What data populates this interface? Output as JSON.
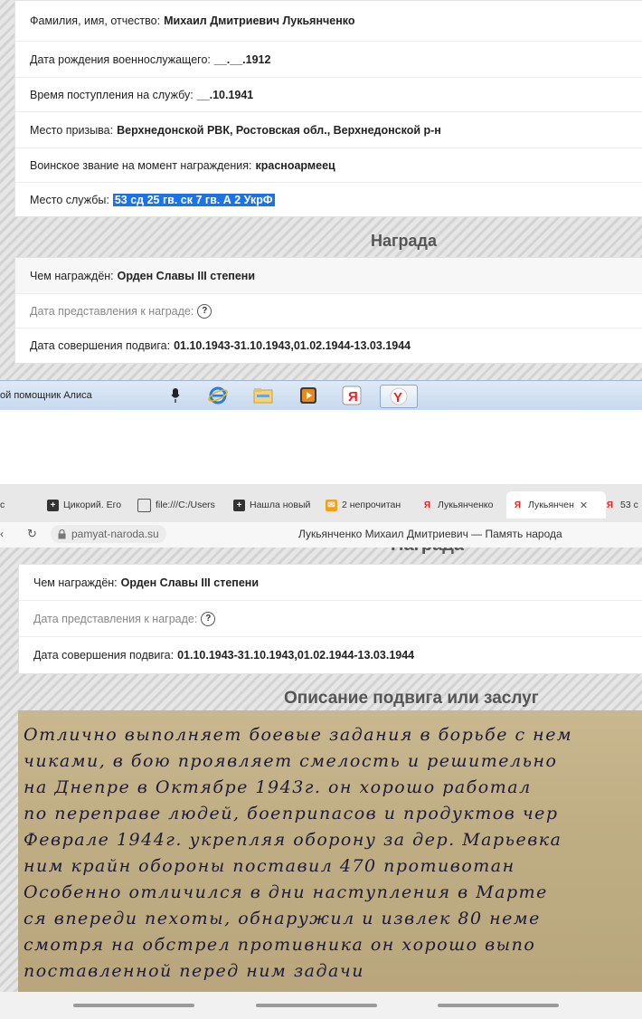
{
  "top": {
    "rows": [
      {
        "label": "Фамилия, имя, отчество:",
        "value": "Михаил Дмитриевич Лукьянченко"
      },
      {
        "label": "Дата рождения военнослужащего:",
        "value": "__.__.1912"
      },
      {
        "label": "Время поступления на службу:",
        "value": "__.10.1941"
      },
      {
        "label": "Место призыва:",
        "value": "Верхнедонской РВК, Ростовская обл., Верхнедонской р-н"
      },
      {
        "label": "Воинское звание на момент награждения:",
        "value": "красноармеец"
      },
      {
        "label": "Место службы:",
        "value": "53 сд 25 гв. ск 7 гв. А 2 УкрФ"
      }
    ],
    "award_title": "Награда",
    "award_rows": [
      {
        "label": "Чем награждён:",
        "value": "Орден Славы III степени"
      },
      {
        "label": "Дата представления к награде:",
        "value": ""
      },
      {
        "label": "Дата совершения подвига:",
        "value": "01.10.1943-31.10.1943,01.02.1944-13.03.1944"
      }
    ]
  },
  "taskbar": {
    "alice_label": "ой помощник Алиса"
  },
  "browser": {
    "tabs": [
      {
        "label": "с"
      },
      {
        "label": "Цикорий. Его"
      },
      {
        "label": "file:///C:/Users"
      },
      {
        "label": "Нашла новый"
      },
      {
        "label": "2 непрочитан"
      },
      {
        "label": "Лукьянченко"
      },
      {
        "label": "Лукьянчен"
      },
      {
        "label": "53 с"
      }
    ],
    "url": "pamyat-naroda.su",
    "page_title": "Лукьянченко Михаил Дмитриевич — Память народа"
  },
  "bottom": {
    "award_title_partial": "Награда",
    "award_rows": [
      {
        "label": "Чем награждён:",
        "value": "Орден Славы III степени"
      },
      {
        "label": "Дата представления к награде:",
        "value": ""
      },
      {
        "label": "Дата совершения подвига:",
        "value": "01.10.1943-31.10.1943,01.02.1944-13.03.1944"
      }
    ],
    "feat_title": "Описание подвига или заслуг",
    "handwriting": [
      "Отлично выполняет боевые задания в борьбе с нем",
      "чиками, в бою проявляет смелость и решительно",
      "на Днепре в Октябре 1943г. он хорошо работал",
      "по переправе людей, боеприпасов и продуктов чер",
      "Феврале 1944г. укрепляя оборону за дер. Марьевка",
      "ним крайн обороны поставил 470 противотан",
      "Особенно отличился в дни наступления в Марте",
      "ся впереди пехоты, обнаружил и извлек 80 неме",
      "смотря на обстрел противника он хорошо выпо",
      "поставленной перед ним задачи"
    ]
  }
}
